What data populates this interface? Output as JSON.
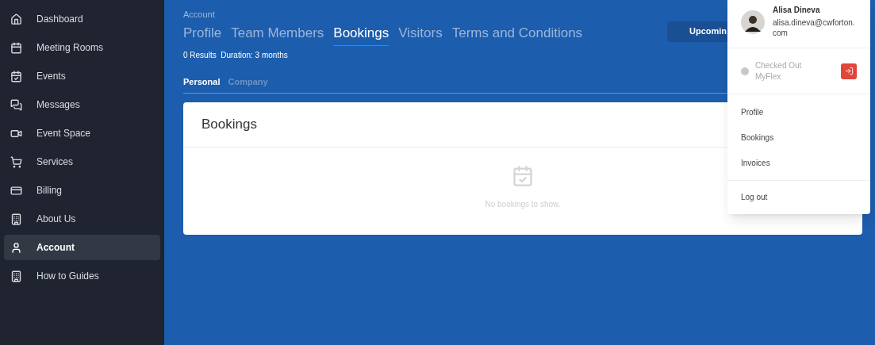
{
  "sidebar": {
    "items": [
      {
        "label": "Dashboard",
        "selected": false
      },
      {
        "label": "Meeting Rooms",
        "selected": false
      },
      {
        "label": "Events",
        "selected": false
      },
      {
        "label": "Messages",
        "selected": false
      },
      {
        "label": "Event Space",
        "selected": false
      },
      {
        "label": "Services",
        "selected": false
      },
      {
        "label": "Billing",
        "selected": false
      },
      {
        "label": "About Us",
        "selected": false
      },
      {
        "label": "Account",
        "selected": true
      },
      {
        "label": "How to Guides",
        "selected": false
      }
    ]
  },
  "header": {
    "breadcrumb": "Account",
    "tabs": [
      {
        "label": "Profile",
        "selected": false
      },
      {
        "label": "Team Members",
        "selected": false
      },
      {
        "label": "Bookings",
        "selected": true
      },
      {
        "label": "Visitors",
        "selected": false
      },
      {
        "label": "Terms and Conditions",
        "selected": false
      }
    ],
    "summary": "0 Results  Duration: 3 months",
    "filter_button": "Upcomin"
  },
  "subtabs": [
    {
      "label": "Personal",
      "selected": true
    },
    {
      "label": "Company",
      "selected": false
    }
  ],
  "card": {
    "title": "Bookings",
    "empty_message": "No bookings to show."
  },
  "user_menu": {
    "name": "Alisa Dineva",
    "email": "alisa.dineva@cwforton.com",
    "status": "Checked Out",
    "location": "MyFlex",
    "items": [
      {
        "label": "Profile"
      },
      {
        "label": "Bookings"
      },
      {
        "label": "Invoices"
      }
    ],
    "logout": "Log out"
  }
}
